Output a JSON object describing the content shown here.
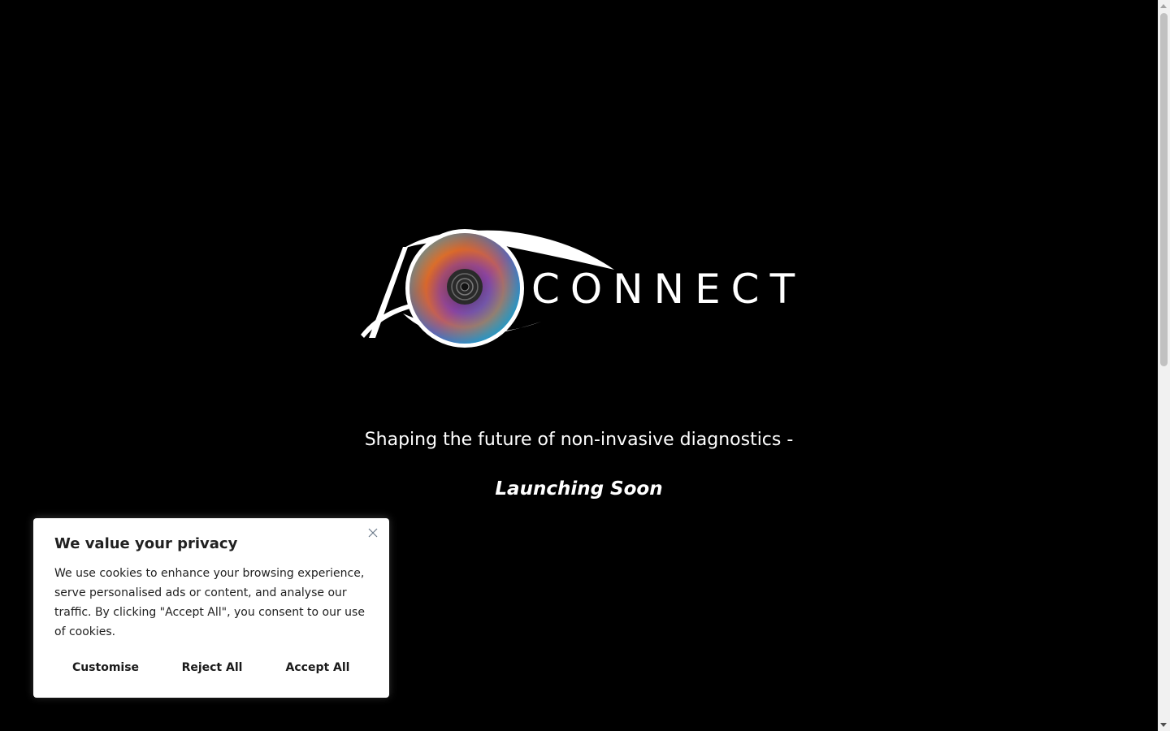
{
  "logo": {
    "text": "CONNECT",
    "icon": "eye-logo-icon"
  },
  "hero": {
    "tagline": "Shaping the future of non-invasive diagnostics -",
    "launching": "Launching Soon"
  },
  "cookie_banner": {
    "title": "We value your privacy",
    "body": "We use cookies to enhance your browsing experience, serve personalised ads or content, and analyse our traffic. By clicking \"Accept All\", you consent to our use of cookies.",
    "close_icon": "close-icon",
    "buttons": {
      "customise": "Customise",
      "reject": "Reject All",
      "accept": "Accept All"
    }
  },
  "colors": {
    "background": "#000000",
    "text": "#ffffff",
    "banner_bg": "#ffffff",
    "banner_text": "#212121"
  }
}
